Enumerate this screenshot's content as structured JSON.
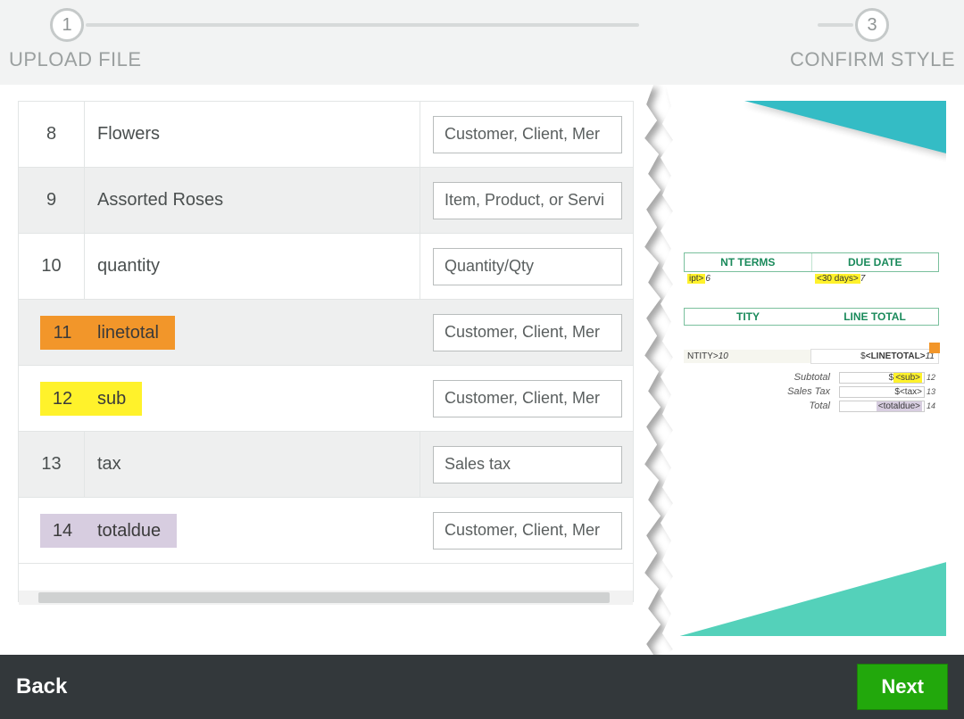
{
  "stepper": {
    "step1_num": "1",
    "step1_label": "UPLOAD FILE",
    "step3_num": "3",
    "step3_label": "CONFIRM STYLE"
  },
  "rows": [
    {
      "num": "8",
      "name": "Flowers",
      "select": "Customer, Client, Mer",
      "shaded": false,
      "highlight": null
    },
    {
      "num": "9",
      "name": "Assorted Roses",
      "select": "Item, Product, or Servi",
      "shaded": true,
      "highlight": null
    },
    {
      "num": "10",
      "name": "quantity",
      "select": "Quantity/Qty",
      "shaded": false,
      "highlight": null
    },
    {
      "num": "11",
      "name": "linetotal",
      "select": "Customer, Client, Mer",
      "shaded": true,
      "highlight": "orange"
    },
    {
      "num": "12",
      "name": "sub",
      "select": "Customer, Client, Mer",
      "shaded": false,
      "highlight": "yellow"
    },
    {
      "num": "13",
      "name": "tax",
      "select": "Sales tax",
      "shaded": true,
      "highlight": null
    },
    {
      "num": "14",
      "name": "totaldue",
      "select": "Customer, Client, Mer",
      "shaded": false,
      "highlight": "lav"
    }
  ],
  "preview": {
    "head1a": "NT TERMS",
    "head1b": "DUE DATE",
    "sub1a_tag": "ipt>",
    "sub1a_idx": "6",
    "sub1b_tag": "<30 days>",
    "sub1b_idx": "7",
    "head2a": "TITY",
    "head2b": "LINE TOTAL",
    "line_a": "NTITY>",
    "line_a_idx": "10",
    "line_b_prefix": "$",
    "line_b_tag": "<LINETOTAL>",
    "line_b_idx": "11",
    "summary": [
      {
        "label": "Subtotal",
        "prefix": "$",
        "tag": "<sub>",
        "idx": "12",
        "tagcls": "yl"
      },
      {
        "label": "Sales Tax",
        "prefix": "$",
        "tag": "<tax>",
        "idx": "13",
        "tagcls": ""
      },
      {
        "label": "Total",
        "prefix": "",
        "tag": "<totaldue>",
        "idx": "14",
        "tagcls": "lv"
      }
    ]
  },
  "footer": {
    "back": "Back",
    "next": "Next"
  }
}
